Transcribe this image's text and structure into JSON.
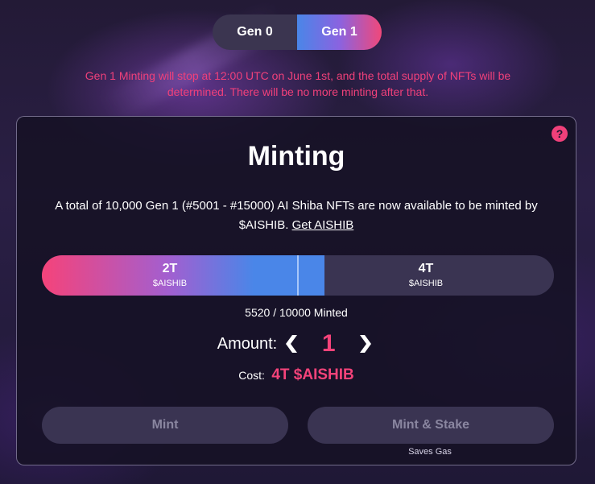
{
  "toggle": {
    "gen0": "Gen 0",
    "gen1": "Gen 1",
    "active": "gen1"
  },
  "notice": "Gen 1 Minting will stop at 12:00 UTC on June 1st, and the total supply of NFTs will be determined. There will be no more minting after that.",
  "card": {
    "help": "?",
    "title": "Minting",
    "description": "A total of 10,000 Gen 1 (#5001 - #15000) AI Shiba NFTs are now available to be minted by $AISHIB.",
    "get_link": "Get AISHIB"
  },
  "progress": {
    "minted": 5520,
    "total": 10000,
    "minted_text": "5520 / 10000 Minted",
    "tier_boundary": 5000,
    "tiers": [
      {
        "price": "2T",
        "unit": "$AISHIB"
      },
      {
        "price": "4T",
        "unit": "$AISHIB"
      }
    ]
  },
  "amount": {
    "label": "Amount:",
    "value": "1"
  },
  "cost": {
    "label": "Cost:",
    "value": "4T $AISHIB"
  },
  "buttons": {
    "mint": "Mint",
    "mint_stake": "Mint & Stake",
    "saves_gas": "Saves Gas"
  },
  "colors": {
    "accent": "#f5437a",
    "blue": "#4a86e8",
    "card_bg": "#161226"
  }
}
